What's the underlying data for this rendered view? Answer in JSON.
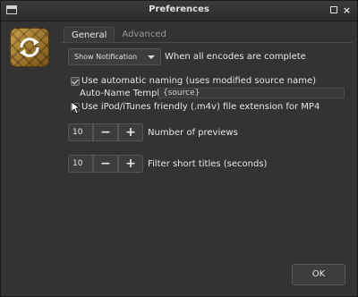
{
  "window": {
    "title": "Preferences",
    "menu_icon": "window-menu-icon",
    "maximize_icon": "maximize-icon",
    "close_glyph": "×"
  },
  "logo": {
    "icon": "handbrake-app-icon"
  },
  "tabs": [
    {
      "label": "General",
      "active": true
    },
    {
      "label": "Advanced",
      "active": false
    }
  ],
  "general": {
    "when_done": {
      "selected": "Show Notification",
      "label": "When all encodes are complete"
    },
    "auto_naming": {
      "checked": true,
      "label": "Use automatic naming (uses modified source name)"
    },
    "auto_name_template": {
      "label": "Auto-Name Template",
      "value": "{source}"
    },
    "ipod_ext": {
      "checked": false,
      "label": "Use iPod/iTunes friendly (.m4v) file extension for MP4"
    },
    "num_previews": {
      "value": "10",
      "minus": "−",
      "plus": "+",
      "label": "Number of previews"
    },
    "filter_short": {
      "value": "10",
      "minus": "−",
      "plus": "+",
      "label": "Filter short titles (seconds)"
    }
  },
  "footer": {
    "ok_label": "OK"
  }
}
